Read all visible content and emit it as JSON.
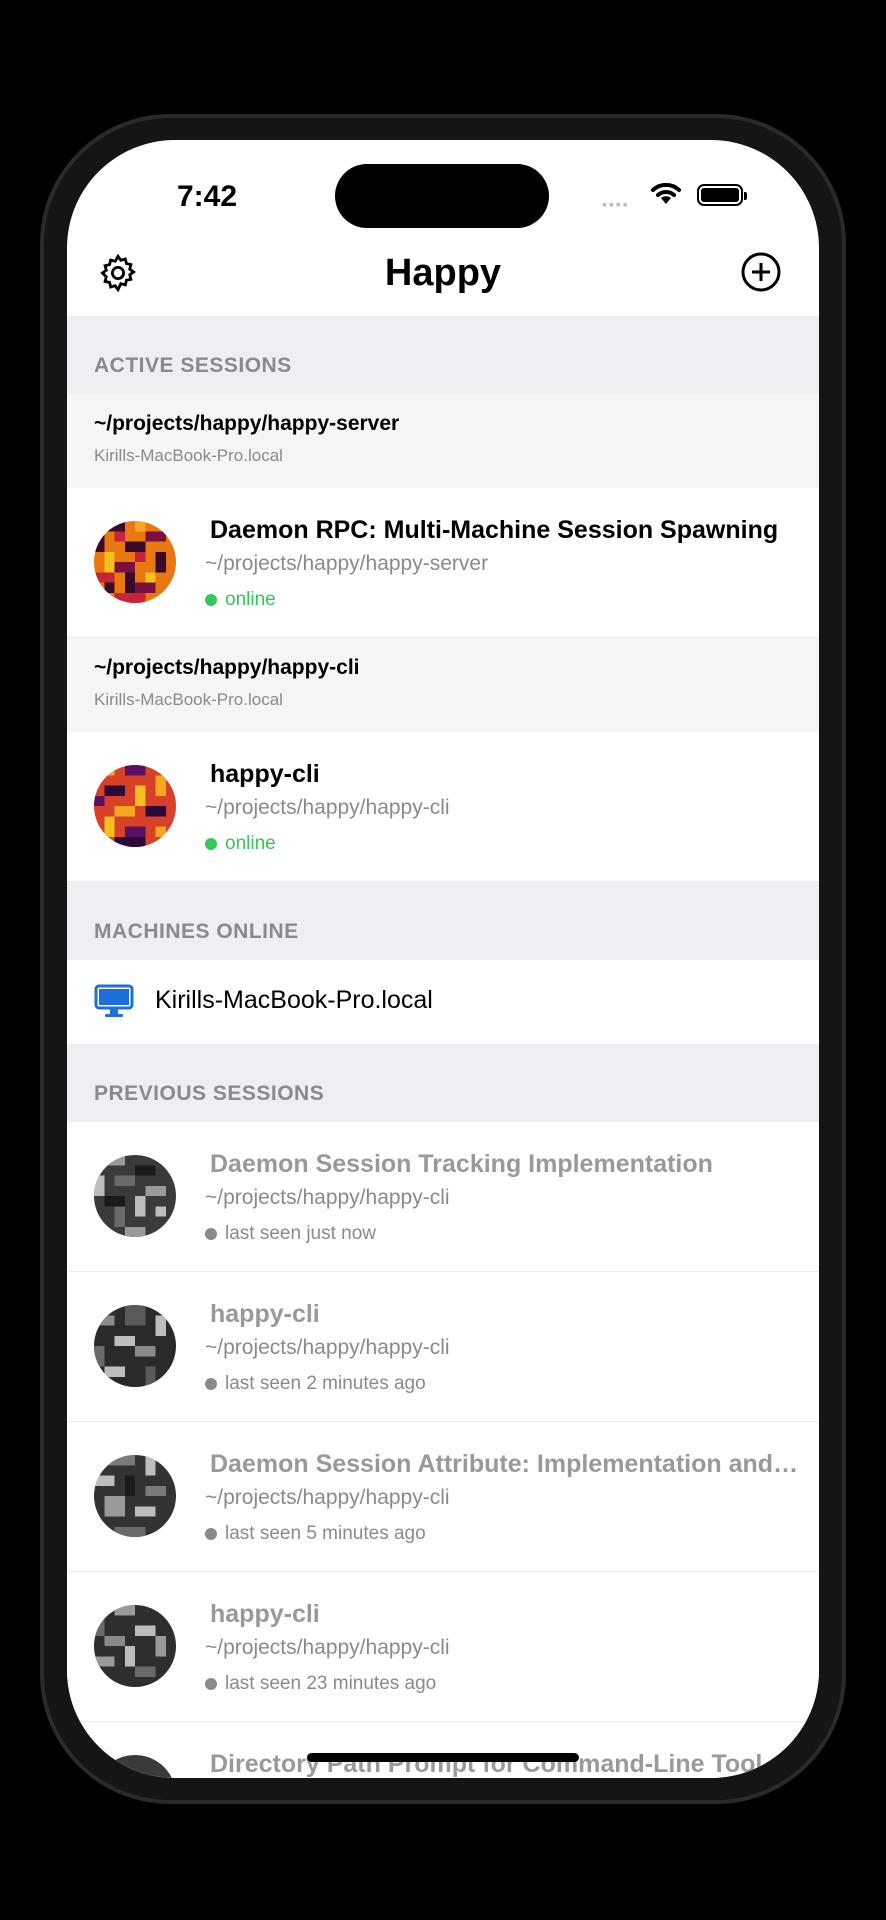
{
  "status": {
    "time": "7:42"
  },
  "nav": {
    "title": "Happy"
  },
  "active": {
    "header": "ACTIVE SESSIONS",
    "groups": [
      {
        "path": "~/projects/happy/happy-server",
        "machine": "Kirills-MacBook-Pro.local",
        "session": {
          "name": "Daemon RPC: Multi-Machine Session Spawning",
          "path": "~/projects/happy/happy-server",
          "status": "online"
        }
      },
      {
        "path": "~/projects/happy/happy-cli",
        "machine": "Kirills-MacBook-Pro.local",
        "session": {
          "name": "happy-cli",
          "path": "~/projects/happy/happy-cli",
          "status": "online"
        }
      }
    ]
  },
  "machines": {
    "header": "MACHINES ONLINE",
    "items": [
      {
        "label": "Kirills-MacBook-Pro.local",
        "icon": "desktop-icon"
      }
    ]
  },
  "previous": {
    "header": "PREVIOUS SESSIONS",
    "items": [
      {
        "name": "Daemon Session Tracking Implementation",
        "path": "~/projects/happy/happy-cli",
        "status": "last seen just now"
      },
      {
        "name": "happy-cli",
        "path": "~/projects/happy/happy-cli",
        "status": "last seen 2 minutes ago"
      },
      {
        "name": "Daemon Session Attribute: Implementation and Testing",
        "path": "~/projects/happy/happy-cli",
        "status": "last seen 5 minutes ago"
      },
      {
        "name": "happy-cli",
        "path": "~/projects/happy/happy-cli",
        "status": "last seen 23 minutes ago"
      },
      {
        "name": "Directory Path Prompt for Command-Line Tool",
        "path": "",
        "status": ""
      }
    ]
  },
  "colors": {
    "online": "#34c759",
    "accent": "#1e6fd9",
    "section_bg": "#efeff3"
  }
}
